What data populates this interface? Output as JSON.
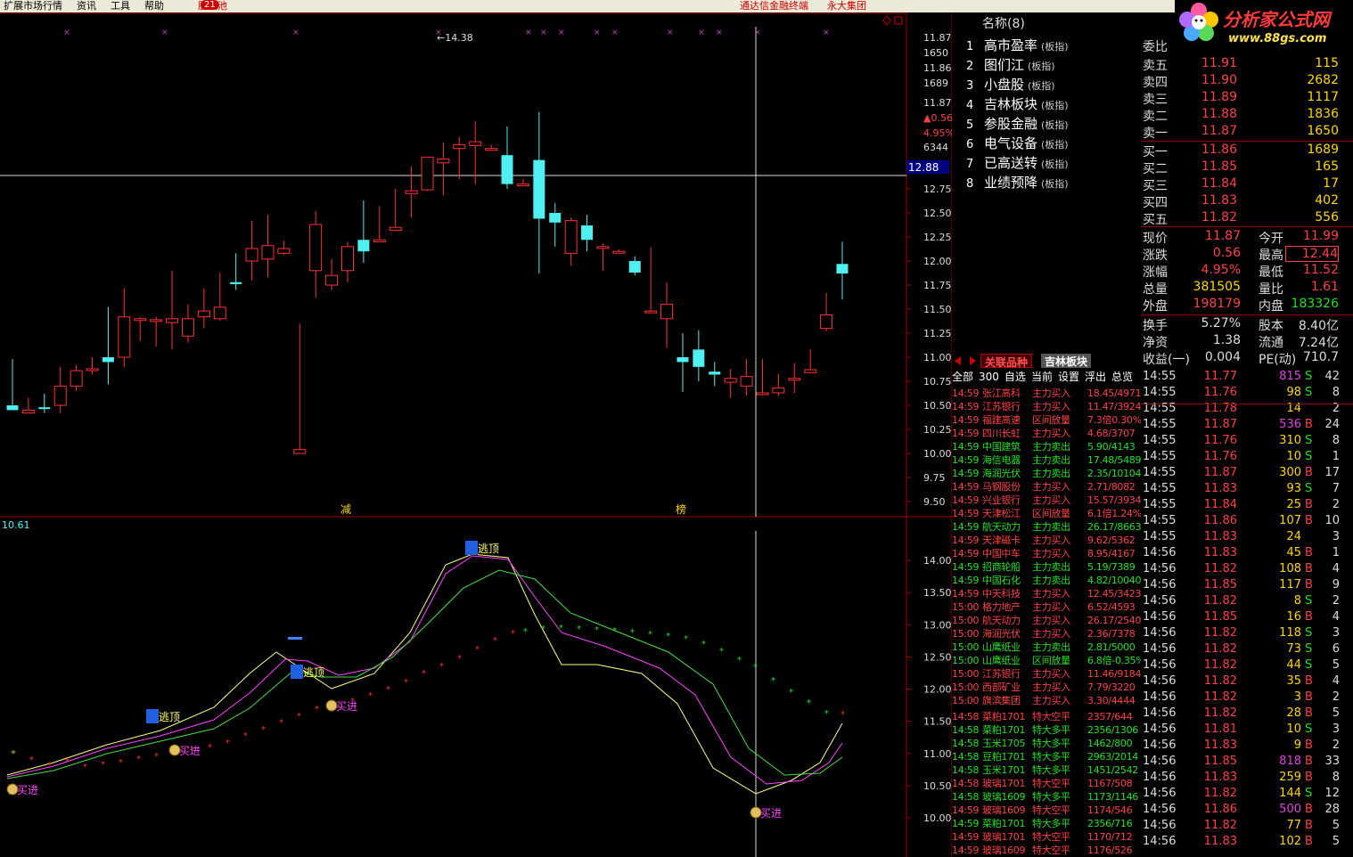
{
  "menu": {
    "items": [
      "扩展市场行情",
      "资讯",
      "工具",
      "帮助"
    ],
    "pool": "股票池",
    "pool_badge": "21",
    "right1": "通达信金融终端",
    "right2": "永大集团"
  },
  "logo": {
    "title": "分析家公式网",
    "url": "www.88gs.com"
  },
  "colors": {
    "up": "#ff3030",
    "down": "#4ef0f0",
    "bg": "#000000",
    "grid": "#a00000"
  },
  "chart_data": [
    {
      "type": "candlestick",
      "name": "",
      "ylim": [
        9.3,
        11.95
      ],
      "yticks": [
        11.87,
        11.86,
        11.87,
        12.75,
        12.5,
        12.25,
        12.0,
        11.75,
        11.5,
        11.25,
        11.0,
        10.75,
        10.5,
        10.25,
        10.0,
        9.75,
        9.5
      ],
      "right_labels": [
        "11.87",
        "1650",
        "11.86",
        "1689",
        "11.87",
        "▲0.56",
        "4.95%",
        "6344"
      ],
      "cursor_price": "12.88",
      "high_label": "14.38",
      "candles": [
        [
          10.5,
          10.45,
          10.98,
          10.5
        ],
        [
          10.42,
          10.45,
          10.58,
          10.45
        ],
        [
          10.48,
          10.47,
          10.42,
          10.62
        ],
        [
          10.5,
          10.7,
          10.42,
          10.9
        ],
        [
          10.7,
          10.86,
          10.65,
          10.92
        ],
        [
          10.88,
          10.88,
          10.82,
          11.0
        ],
        [
          11.0,
          10.95,
          10.72,
          11.52
        ],
        [
          11.0,
          11.42,
          10.9,
          11.72
        ],
        [
          11.4,
          11.4,
          11.17,
          11.42
        ],
        [
          11.38,
          11.39,
          11.11,
          11.42
        ],
        [
          11.36,
          11.4,
          11.08,
          11.9
        ],
        [
          11.22,
          11.4,
          11.15,
          11.55
        ],
        [
          11.42,
          11.48,
          11.3,
          11.72
        ],
        [
          11.4,
          11.52,
          11.38,
          11.88
        ],
        [
          11.78,
          11.76,
          11.7,
          12.08
        ],
        [
          12.0,
          12.13,
          11.8,
          12.42
        ],
        [
          12.02,
          12.16,
          11.83,
          12.48
        ],
        [
          12.08,
          12.13,
          12.06,
          12.21
        ],
        [
          10.0,
          10.04,
          10.0,
          11.35
        ],
        [
          11.9,
          12.38,
          11.62,
          12.52
        ],
        [
          11.75,
          11.85,
          11.7,
          12.02
        ],
        [
          11.9,
          12.15,
          11.78,
          12.2
        ],
        [
          12.22,
          12.1,
          11.98,
          12.63
        ],
        [
          12.2,
          12.22,
          12.2,
          12.57
        ],
        [
          12.32,
          12.35,
          12.32,
          12.75
        ],
        [
          12.7,
          12.73,
          12.45,
          12.98
        ],
        [
          12.74,
          13.08,
          12.73,
          13.06
        ],
        [
          13.02,
          13.06,
          12.68,
          13.23
        ],
        [
          13.17,
          13.21,
          12.85,
          13.29
        ],
        [
          13.2,
          13.24,
          12.8,
          13.45
        ],
        [
          13.17,
          13.17,
          13.17,
          13.21
        ],
        [
          13.1,
          12.8,
          12.75,
          13.4
        ],
        [
          12.8,
          12.8,
          12.8,
          12.85
        ],
        [
          13.05,
          12.44,
          11.87,
          13.55
        ],
        [
          12.5,
          12.4,
          12.15,
          12.6
        ],
        [
          12.08,
          12.42,
          11.95,
          12.45
        ],
        [
          12.37,
          12.22,
          12.1,
          12.48
        ],
        [
          12.15,
          12.15,
          11.9,
          12.18
        ],
        [
          12.1,
          12.1,
          12.08,
          12.12
        ],
        [
          12.0,
          11.88,
          11.85,
          12.05
        ],
        [
          11.48,
          11.48,
          11.48,
          12.14
        ],
        [
          11.4,
          11.55,
          11.1,
          11.78
        ],
        [
          11.0,
          10.95,
          10.64,
          11.25
        ],
        [
          11.08,
          10.9,
          10.75,
          11.28
        ],
        [
          10.85,
          10.82,
          10.7,
          10.95
        ],
        [
          10.74,
          10.78,
          10.58,
          10.88
        ],
        [
          10.7,
          10.8,
          10.6,
          10.98
        ],
        [
          10.62,
          10.63,
          10.6,
          10.98
        ],
        [
          10.63,
          10.68,
          10.6,
          10.83
        ],
        [
          10.78,
          10.78,
          10.63,
          10.94
        ],
        [
          10.84,
          10.87,
          10.84,
          11.08
        ],
        [
          11.3,
          11.44,
          11.27,
          11.67
        ],
        [
          11.97,
          11.87,
          11.6,
          12.2
        ]
      ],
      "markers": [
        "减",
        "榜"
      ]
    },
    {
      "type": "line",
      "name": "",
      "ylim": [
        9.77,
        14.45
      ],
      "yticks": [
        "14.00",
        "13.50",
        "13.00",
        "12.50",
        "12.00",
        "11.50",
        "11.00",
        "10.50",
        "10.00"
      ],
      "top_label": "10.61",
      "signals": [
        {
          "label": "买进",
          "x": 14
        },
        {
          "label": "逃顶",
          "x": 180
        },
        {
          "label": "买进",
          "x": 196
        },
        {
          "label": "逃顶",
          "x": 342
        },
        {
          "label": "买进",
          "x": 372
        },
        {
          "label": "逃顶",
          "x": 538
        },
        {
          "label": "买进",
          "x": 848
        }
      ]
    }
  ],
  "namelist": {
    "header": "名称(8)",
    "items": [
      {
        "n": "1",
        "name": "高市盈率",
        "tag": "(板指)"
      },
      {
        "n": "2",
        "name": "图们江",
        "tag": "(板指)"
      },
      {
        "n": "3",
        "name": "小盘股",
        "tag": "(板指)"
      },
      {
        "n": "4",
        "name": "吉林板块",
        "tag": "(板指)"
      },
      {
        "n": "5",
        "name": "参股金融",
        "tag": "(板指)"
      },
      {
        "n": "6",
        "name": "电气设备",
        "tag": "(板指)"
      },
      {
        "n": "7",
        "name": "已高送转",
        "tag": "(板指)"
      },
      {
        "n": "8",
        "name": "业绩预降",
        "tag": "(板指)"
      }
    ]
  },
  "tabs": {
    "t1": "关联品种",
    "t2": "吉林板块",
    "sub": [
      "全部",
      "300",
      "自选",
      "当前",
      "设置",
      "浮出",
      "总览"
    ]
  },
  "news": [
    [
      "14:59",
      "张江高科",
      "主力买入",
      "18.45/4971",
      "r"
    ],
    [
      "14:59",
      "江苏银行",
      "主力买入",
      "11.47/3924",
      "r"
    ],
    [
      "14:59",
      "福建高速",
      "区间放量",
      "7.3倍0.30%",
      "r"
    ],
    [
      "14:59",
      "四川长虹",
      "主力买入",
      "4.68/3707",
      "r"
    ],
    [
      "14:59",
      "中国建筑",
      "主力卖出",
      "5.90/4143",
      "g"
    ],
    [
      "14:59",
      "海信电器",
      "主力卖出",
      "17.48/5489",
      "g"
    ],
    [
      "14:59",
      "海润光伏",
      "主力卖出",
      "2.35/10104",
      "g"
    ],
    [
      "14:59",
      "马钢股份",
      "主力买入",
      "2.71/8082",
      "r"
    ],
    [
      "14:59",
      "兴业银行",
      "主力买入",
      "15.57/3934",
      "r"
    ],
    [
      "14:59",
      "天津松江",
      "区间放量",
      "6.1倍1.24%",
      "r"
    ],
    [
      "14:59",
      "航天动力",
      "主力卖出",
      "26.17/8663",
      "g"
    ],
    [
      "14:59",
      "天津磁卡",
      "主力买入",
      "9.62/5362",
      "r"
    ],
    [
      "14:59",
      "中国中车",
      "主力买入",
      "8.95/4167",
      "r"
    ],
    [
      "14:59",
      "招商轮船",
      "主力卖出",
      "5.19/7389",
      "g"
    ],
    [
      "14:59",
      "中国石化",
      "主力卖出",
      "4.82/10040",
      "g"
    ],
    [
      "14:59",
      "中天科技",
      "主力买入",
      "12.45/3423",
      "r"
    ],
    [
      "15:00",
      "格力地产",
      "主力买入",
      "6.52/4593",
      "r"
    ],
    [
      "15:00",
      "航天动力",
      "主力买入",
      "26.17/2540",
      "r"
    ],
    [
      "15:00",
      "海润光伏",
      "主力买入",
      "2.36/7378",
      "r"
    ],
    [
      "15:00",
      "山鹰纸业",
      "主力卖出",
      "2.81/5000",
      "g"
    ],
    [
      "15:00",
      "山鹰纸业",
      "区间放量",
      "6.8倍-0.35%",
      "g"
    ],
    [
      "15:00",
      "江苏银行",
      "主力买入",
      "11.46/9184",
      "r"
    ],
    [
      "15:00",
      "西部矿业",
      "主力买入",
      "7.79/3220",
      "r"
    ],
    [
      "15:00",
      "旗滨集团",
      "主力买入",
      "3.30/4444",
      "r"
    ],
    [
      "14:58",
      "菜粕1701",
      "特大空平",
      "2357/644",
      "r"
    ],
    [
      "14:58",
      "菜粕1701",
      "特大多平",
      "2356/1306",
      "g"
    ],
    [
      "14:58",
      "玉米1705",
      "特大多平",
      "1462/800",
      "g"
    ],
    [
      "14:58",
      "豆粕1701",
      "特大多平",
      "2963/2014",
      "g"
    ],
    [
      "14:58",
      "玉米1701",
      "特大多平",
      "1451/2542",
      "g"
    ],
    [
      "14:58",
      "玻璃1701",
      "特大空平",
      "1167/508",
      "r"
    ],
    [
      "14:58",
      "玻璃1609",
      "特大多平",
      "1173/1146",
      "g"
    ],
    [
      "14:59",
      "玻璃1609",
      "特大空平",
      "1174/546",
      "r"
    ],
    [
      "14:59",
      "菜粕1701",
      "特大多平",
      "2356/716",
      "g"
    ],
    [
      "14:59",
      "玻璃1701",
      "特大空平",
      "1170/712",
      "r"
    ],
    [
      "14:59",
      "玻璃1609",
      "特大空平",
      "1176/526",
      "r"
    ]
  ],
  "quote": {
    "weibi_label": "委比",
    "asks": [
      [
        "卖五",
        "11.91",
        "115"
      ],
      [
        "卖四",
        "11.90",
        "2682"
      ],
      [
        "卖三",
        "11.89",
        "1117"
      ],
      [
        "卖二",
        "11.88",
        "1836"
      ],
      [
        "卖一",
        "11.87",
        "1650"
      ]
    ],
    "bids": [
      [
        "买一",
        "11.86",
        "1689"
      ],
      [
        "买二",
        "11.85",
        "165"
      ],
      [
        "买三",
        "11.84",
        "17"
      ],
      [
        "买四",
        "11.83",
        "402"
      ],
      [
        "买五",
        "11.82",
        "556"
      ]
    ],
    "stats": [
      [
        "现价",
        "11.87",
        "今开",
        "11.99",
        "r",
        "r"
      ],
      [
        "涨跌",
        "0.56",
        "最高",
        "12.44",
        "r",
        "r"
      ],
      [
        "涨幅",
        "4.95%",
        "最低",
        "11.52",
        "r",
        "r"
      ],
      [
        "总量",
        "381505",
        "量比",
        "1.61",
        "y",
        "r"
      ],
      [
        "外盘",
        "198179",
        "内盘",
        "183326",
        "r",
        "g"
      ]
    ],
    "stats2": [
      [
        "换手",
        "5.27%",
        "股本",
        "8.40亿"
      ],
      [
        "净资",
        "1.38",
        "流通",
        "7.24亿"
      ],
      [
        "收益(一)",
        "0.004",
        "PE(动)",
        "710.7"
      ]
    ]
  },
  "ticks": [
    [
      "14:55",
      "11.77",
      "815",
      "S",
      "42",
      "g"
    ],
    [
      "14:55",
      "11.76",
      "98",
      "S",
      "8",
      "g"
    ],
    [
      "14:55",
      "11.78",
      "14",
      "",
      "2",
      "w"
    ],
    [
      "14:55",
      "11.87",
      "536",
      "B",
      "24",
      "r"
    ],
    [
      "14:55",
      "11.76",
      "310",
      "S",
      "8",
      "g"
    ],
    [
      "14:55",
      "11.76",
      "10",
      "S",
      "1",
      "g"
    ],
    [
      "14:55",
      "11.87",
      "300",
      "B",
      "17",
      "r"
    ],
    [
      "14:55",
      "11.83",
      "93",
      "S",
      "7",
      "g"
    ],
    [
      "14:55",
      "11.84",
      "25",
      "B",
      "2",
      "r"
    ],
    [
      "14:55",
      "11.86",
      "107",
      "B",
      "10",
      "r"
    ],
    [
      "14:55",
      "11.83",
      "24",
      "",
      "3",
      "w"
    ],
    [
      "14:56",
      "11.83",
      "45",
      "B",
      "1",
      "r"
    ],
    [
      "14:56",
      "11.82",
      "108",
      "B",
      "4",
      "r"
    ],
    [
      "14:56",
      "11.85",
      "117",
      "B",
      "9",
      "r"
    ],
    [
      "14:56",
      "11.82",
      "8",
      "S",
      "2",
      "g"
    ],
    [
      "14:56",
      "11.85",
      "16",
      "B",
      "4",
      "r"
    ],
    [
      "14:56",
      "11.82",
      "118",
      "S",
      "3",
      "g"
    ],
    [
      "14:56",
      "11.82",
      "73",
      "S",
      "6",
      "g"
    ],
    [
      "14:56",
      "11.82",
      "44",
      "S",
      "5",
      "g"
    ],
    [
      "14:56",
      "11.82",
      "35",
      "B",
      "4",
      "r"
    ],
    [
      "14:56",
      "11.82",
      "3",
      "B",
      "2",
      "r"
    ],
    [
      "14:56",
      "11.82",
      "28",
      "B",
      "5",
      "r"
    ],
    [
      "14:56",
      "11.81",
      "10",
      "S",
      "3",
      "g"
    ],
    [
      "14:56",
      "11.83",
      "9",
      "B",
      "2",
      "r"
    ],
    [
      "14:56",
      "11.85",
      "818",
      "B",
      "33",
      "r"
    ],
    [
      "14:56",
      "11.83",
      "259",
      "B",
      "8",
      "r"
    ],
    [
      "14:56",
      "11.82",
      "144",
      "S",
      "12",
      "g"
    ],
    [
      "14:56",
      "11.86",
      "500",
      "B",
      "28",
      "r"
    ],
    [
      "14:56",
      "11.82",
      "77",
      "B",
      "5",
      "r"
    ],
    [
      "14:56",
      "11.83",
      "102",
      "B",
      "5",
      "r"
    ]
  ]
}
